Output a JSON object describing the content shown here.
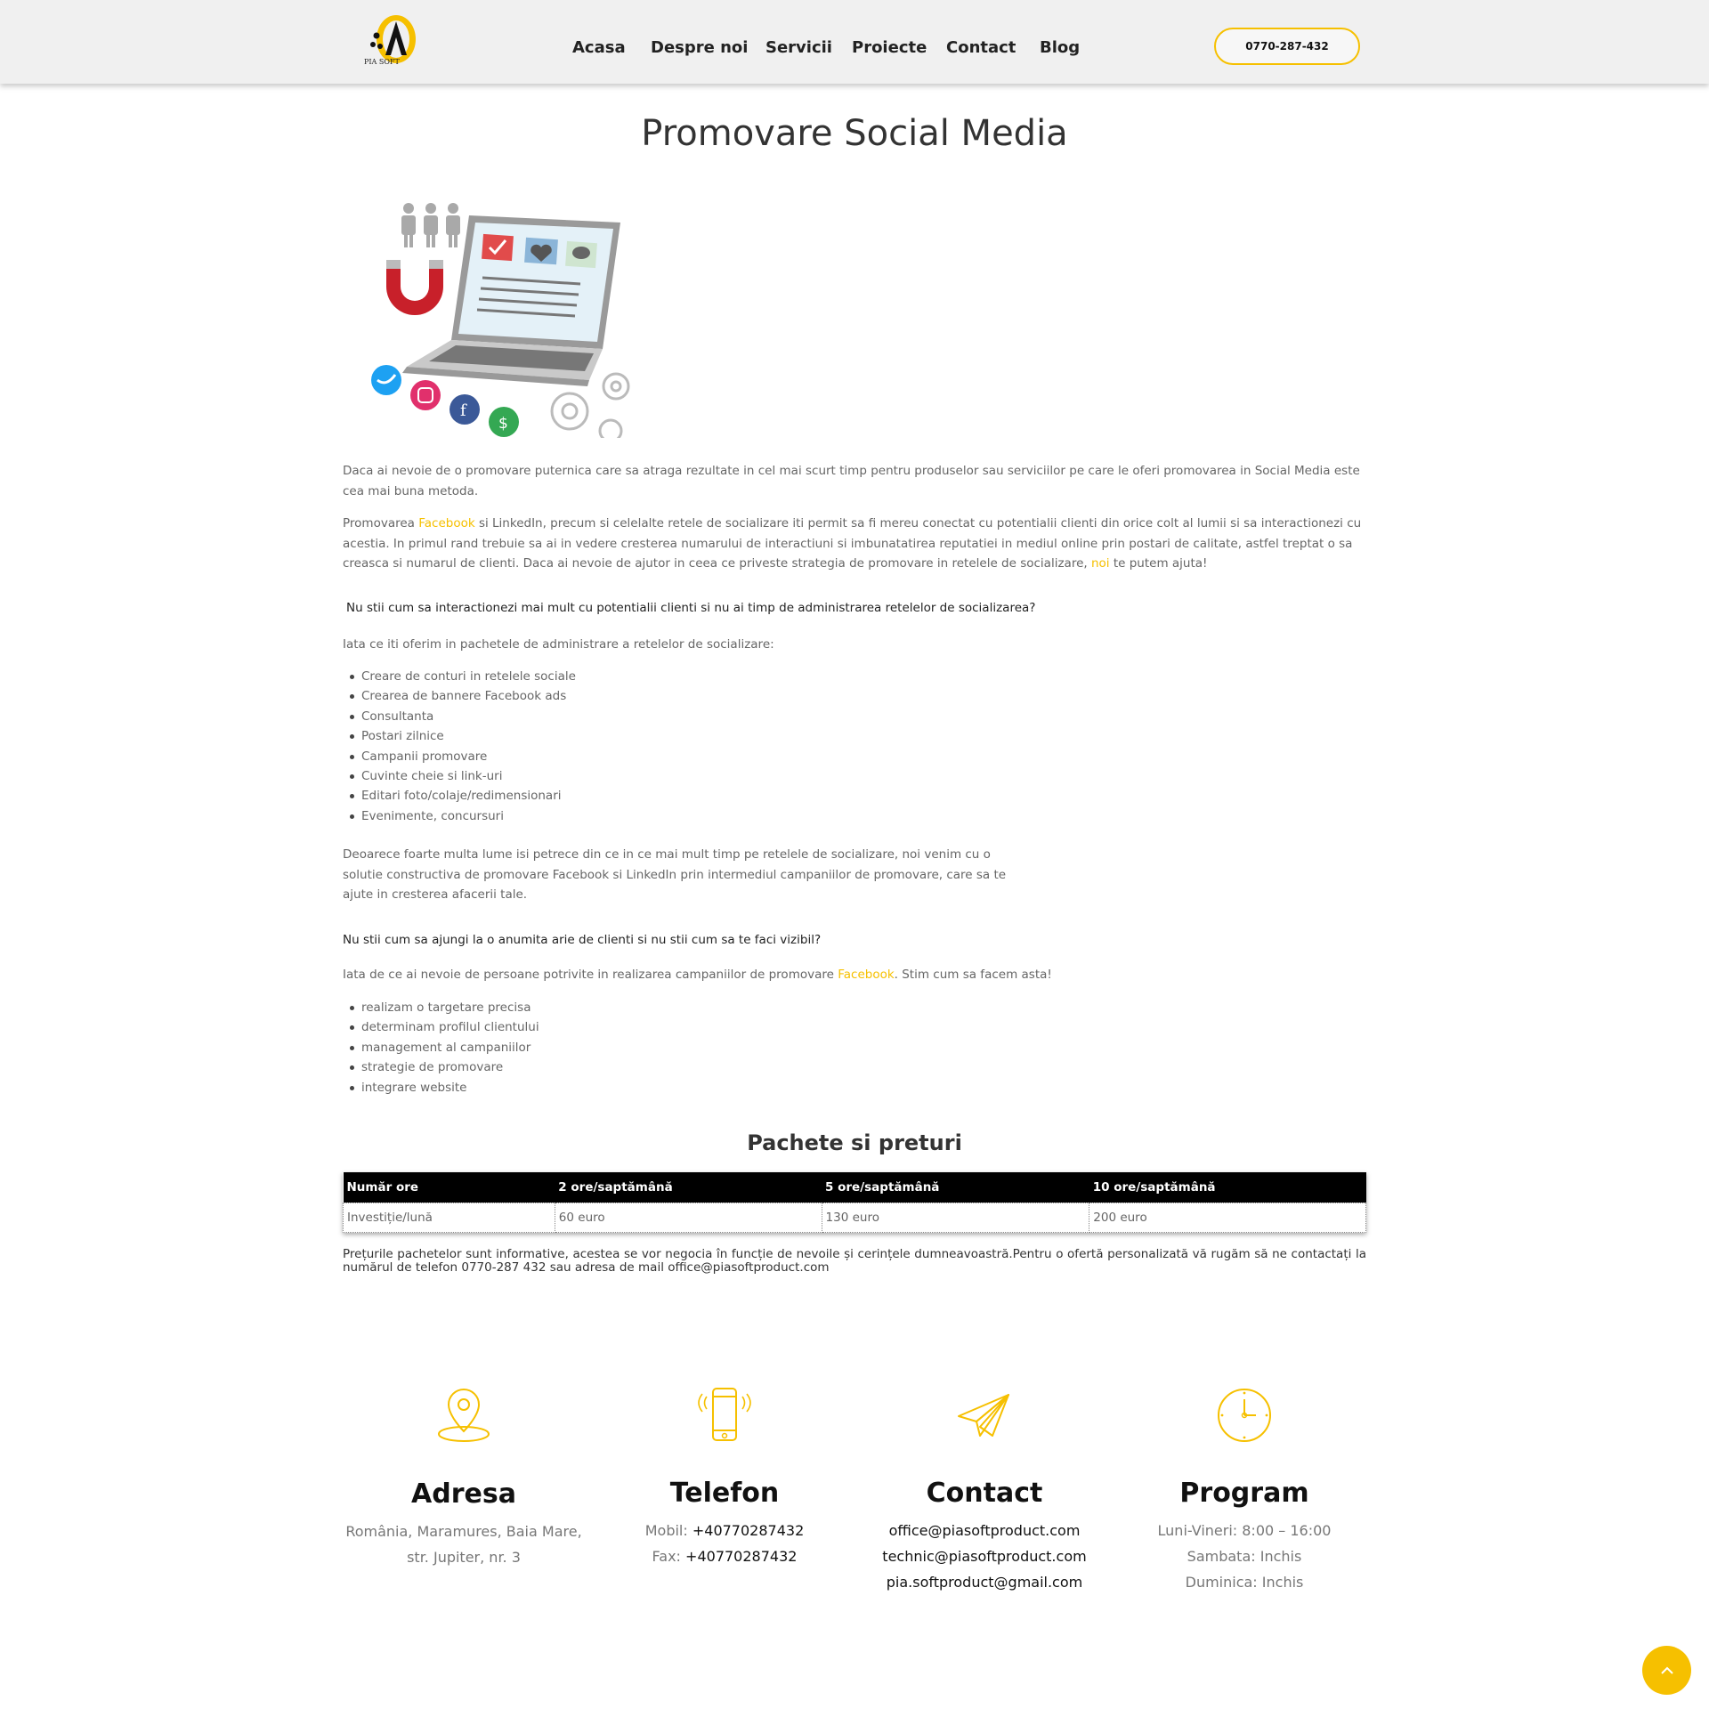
{
  "header": {
    "logo_text": "PIA SOFT",
    "nav": [
      "Acasa",
      "Despre noi",
      "Servicii",
      "Proiecte",
      "Contact",
      "Blog"
    ],
    "phone": "0770-287-432"
  },
  "page": {
    "title": "Promovare Social Media",
    "p1": "Daca ai nevoie de o promovare puternica care sa atraga rezultate in cel mai scurt timp pentru produselor sau serviciilor pe care le oferi promovarea in Social Media este cea mai buna metoda.",
    "p2_before": "Promovarea ",
    "p2_link1": "Facebook",
    "p2_middle": " si LinkedIn, precum si celelalte retele de socializare iti permit sa fi mereu conectat cu potentialii clienti din orice colt al lumii si sa interactionezi cu acestia. In primul rand trebuie sa ai in vedere cresterea numarului de interactiuni si imbunatatirea reputatiei in mediul online prin postari de calitate, astfel treptat o sa creasca si numarul de clienti. Daca ai nevoie de ajutor in ceea ce priveste strategia de promovare in retelele de socializare, ",
    "p2_link2": "noi",
    "p2_after": " te putem ajuta!",
    "q1": "Nu stii cum sa interactionezi mai mult cu potentialii clienti si nu ai timp de administrarea retelelor de socializarea?",
    "intro1": "Iata ce iti oferim in pachetele de administrare a retelelor de socializare:",
    "list1": [
      "Creare de conturi in retelele sociale",
      "Crearea de bannere Facebook ads",
      "Consultanta",
      "Postari zilnice",
      "Campanii promovare",
      "Cuvinte cheie si link-uri",
      "Editari foto/colaje/redimensionari",
      "Evenimente, concursuri"
    ],
    "p3": "Deoarece foarte multa lume isi petrece din ce in ce mai mult timp pe retelele de socializare, noi venim cu o solutie constructiva de promovare Facebook si LinkedIn prin intermediul campaniilor de promovare, care sa te ajute in cresterea afacerii tale.",
    "q2": "Nu stii cum sa ajungi la o anumita arie de clienti si nu stii cum sa te faci vizibil?",
    "intro2_before": "Iata de ce ai nevoie de persoane potrivite in realizarea campaniilor de promovare ",
    "intro2_link": "Facebook",
    "intro2_after": ". Stim cum sa facem asta!",
    "list2": [
      "realizam o targetare precisa",
      "determinam profilul clientului",
      "management al campaniilor",
      "strategie de promovare",
      "integrare website"
    ],
    "packages_title": "Pachete si preturi",
    "table": {
      "headers": [
        "Număr ore",
        "2 ore/saptămână",
        "5 ore/saptămână",
        "10 ore/saptămână"
      ],
      "row": [
        "Investiție/lună",
        "60 euro",
        "130 euro",
        "200 euro"
      ]
    },
    "note": "Prețurile pachetelor sunt informative, acestea se vor negocia în funcție de nevoile și cerințele dumneavoastră.Pentru o ofertă personalizată vă rugăm să ne contactați la numărul de telefon 0770-287 432 sau adresa de mail office@piasoftproduct.com"
  },
  "footer": {
    "address": {
      "title": "Adresa",
      "line1": "România, Maramures, Baia Mare,",
      "line2": "str. Jupiter, nr. 3"
    },
    "phone": {
      "title": "Telefon",
      "mobile_label": "Mobil:",
      "mobile": "+40770287432",
      "fax_label": "Fax:",
      "fax": "+40770287432"
    },
    "contact": {
      "title": "Contact",
      "emails": [
        "office@piasoftproduct.com",
        "technic@piasoftproduct.com",
        "pia.softproduct@gmail.com"
      ]
    },
    "program": {
      "title": "Program",
      "lines": [
        "Luni-Vineri: 8:00 – 16:00",
        "Sambata: Inchis",
        "Duminica: Inchis"
      ]
    }
  },
  "colors": {
    "accent": "#f6c000",
    "header_bg": "#f0f0f0",
    "table_header": "#000000"
  },
  "icons": [
    "location-pin-icon",
    "mobile-phone-icon",
    "paper-plane-icon",
    "clock-icon",
    "chevron-up-icon"
  ]
}
